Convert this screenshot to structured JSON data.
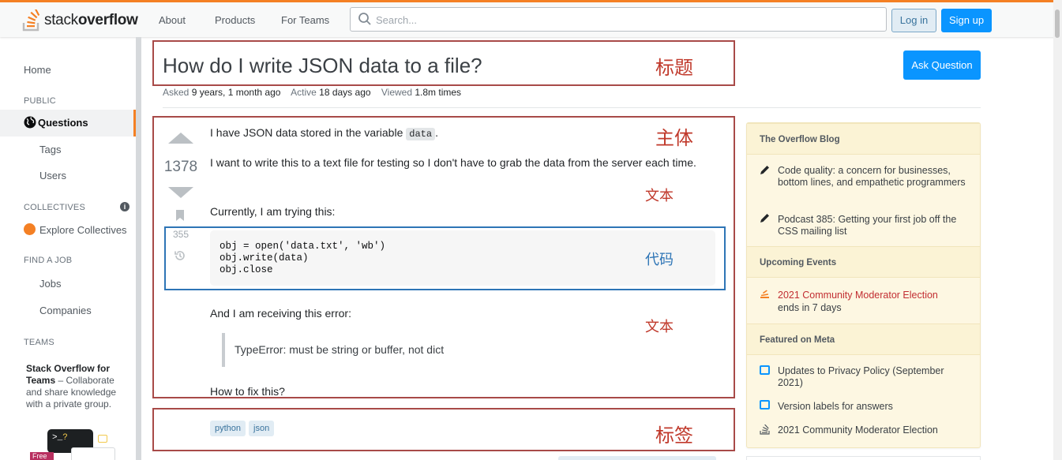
{
  "header": {
    "logo_regular": "stack",
    "logo_bold": "overflow",
    "nav": [
      "About",
      "Products",
      "For Teams"
    ],
    "search_placeholder": "Search...",
    "login_label": "Log in",
    "signup_label": "Sign up",
    "accent_color": "#f48024"
  },
  "sidebar": {
    "home": "Home",
    "public_heading": "PUBLIC",
    "questions": "Questions",
    "tags": "Tags",
    "users": "Users",
    "collectives_heading": "COLLECTIVES",
    "explore_collectives": "Explore Collectives",
    "find_job_heading": "FIND A JOB",
    "jobs": "Jobs",
    "companies": "Companies",
    "teams_heading": "TEAMS",
    "teams_title": "Stack Overflow for Teams",
    "teams_desc": " – Collaborate and share knowledge with a private group.",
    "teams_illus_prompt": ">_",
    "teams_illus_q": "?",
    "teams_free": "Free"
  },
  "question": {
    "title": "How do I write JSON data to a file?",
    "asked_label": "Asked",
    "asked_value": "9 years, 1 month ago",
    "active_label": "Active",
    "active_value": "18 days ago",
    "viewed_label": "Viewed",
    "viewed_value": "1.8m times",
    "ask_button": "Ask Question",
    "votes": "1378",
    "bookmarks": "355",
    "p1_before": "I have JSON data stored in the variable ",
    "p1_code": "data",
    "p1_after": ".",
    "p2": "I want to write this to a text file for testing so I don't have to grab the data from the server each time.",
    "p3": "Currently, I am trying this:",
    "code": "obj = open('data.txt', 'wb')\nobj.write(data)\nobj.close",
    "p4": "And I am receiving this error:",
    "quote": "TypeError: must be string or buffer, not dict",
    "p5": "How to fix this?",
    "tags": [
      "python",
      "json"
    ]
  },
  "annotations": {
    "title": "标题",
    "body": "主体",
    "text1": "文本",
    "code": "代码",
    "text2": "文本",
    "tags": "标签",
    "red_color": "#a84a48",
    "blue_color": "#2e75b6"
  },
  "right_sidebar": {
    "blog_heading": "The Overflow Blog",
    "blog_items": [
      "Code quality: a concern for businesses, bottom lines, and empathetic programmers",
      "Podcast 385: Getting your first job off the CSS mailing list"
    ],
    "events_heading": "Upcoming Events",
    "event_title": "2021 Community Moderator Election",
    "event_sub": "ends in 7 days",
    "meta_heading": "Featured on Meta",
    "meta_items": [
      "Updates to Privacy Policy (September 2021)",
      "Version labels for answers",
      "2021 Community Moderator Election"
    ]
  }
}
